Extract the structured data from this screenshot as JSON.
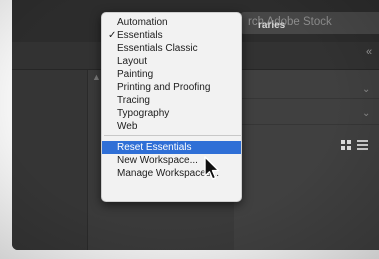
{
  "header": {
    "search_placeholder": "rch Adobe Stock"
  },
  "panel": {
    "tab_label": "raries"
  },
  "workspace_menu": {
    "items": [
      {
        "label": "Automation",
        "checked": false,
        "highlighted": false
      },
      {
        "label": "Essentials",
        "checked": true,
        "highlighted": false
      },
      {
        "label": "Essentials Classic",
        "checked": false,
        "highlighted": false
      },
      {
        "label": "Layout",
        "checked": false,
        "highlighted": false
      },
      {
        "label": "Painting",
        "checked": false,
        "highlighted": false
      },
      {
        "label": "Printing and Proofing",
        "checked": false,
        "highlighted": false
      },
      {
        "label": "Tracing",
        "checked": false,
        "highlighted": false
      },
      {
        "label": "Typography",
        "checked": false,
        "highlighted": false
      },
      {
        "label": "Web",
        "checked": false,
        "highlighted": false
      },
      {
        "label": "Reset Essentials",
        "checked": false,
        "highlighted": true
      },
      {
        "label": "New Workspace...",
        "checked": false,
        "highlighted": false
      },
      {
        "label": "Manage Workspaces...",
        "checked": false,
        "highlighted": false
      }
    ],
    "check_glyph": "✓"
  },
  "icons": {
    "grid_view": "grid-view-icon",
    "list_view": "list-view-icon",
    "cursor": "arrow-cursor-icon"
  },
  "colors": {
    "menu_highlight": "#2f6fd6",
    "menu_background": "#f2f2f2",
    "app_background": "#3a3a3a"
  }
}
